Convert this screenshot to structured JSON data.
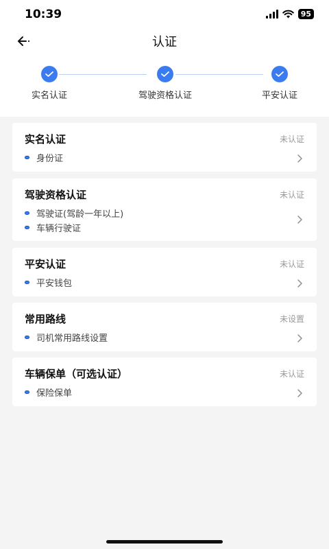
{
  "status_bar": {
    "time": "10:39",
    "battery": "95"
  },
  "nav": {
    "title": "认证"
  },
  "steps": [
    {
      "label": "实名认证"
    },
    {
      "label": "驾驶资格认证"
    },
    {
      "label": "平安认证"
    }
  ],
  "cards": [
    {
      "title": "实名认证",
      "status": "未认证",
      "items": [
        "身份证"
      ]
    },
    {
      "title": "驾驶资格认证",
      "status": "未认证",
      "items": [
        "驾驶证(驾龄一年以上)",
        "车辆行驶证"
      ]
    },
    {
      "title": "平安认证",
      "status": "未认证",
      "items": [
        "平安钱包"
      ]
    },
    {
      "title": "常用路线",
      "status": "未设置",
      "items": [
        "司机常用路线设置"
      ]
    },
    {
      "title": "车辆保单（可选认证）",
      "status": "未认证",
      "items": [
        "保险保单"
      ]
    }
  ],
  "colors": {
    "accent": "#3a7cf0",
    "background": "#f4f4f5",
    "muted": "#9a9a9a"
  }
}
